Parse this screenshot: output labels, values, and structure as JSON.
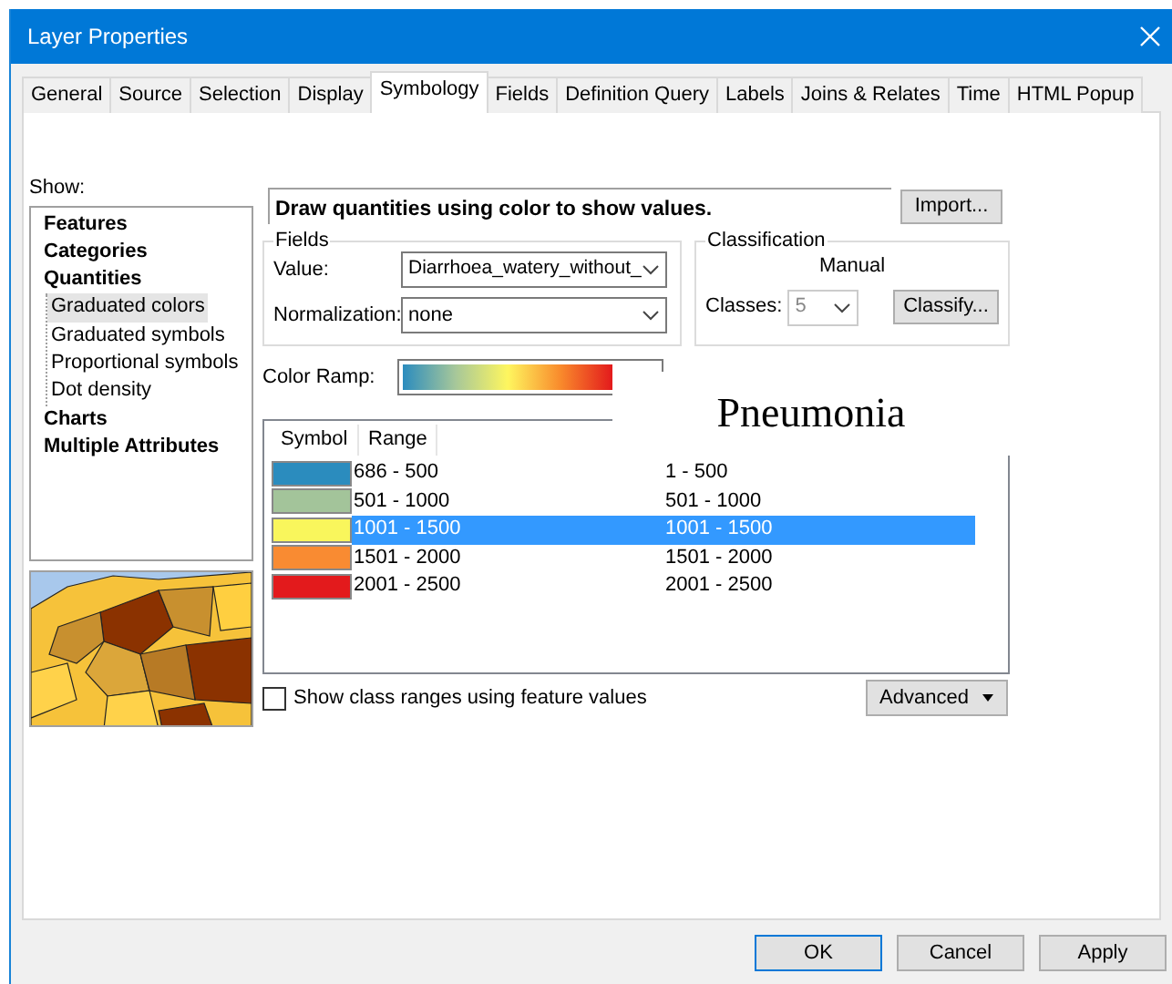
{
  "window": {
    "title": "Layer Properties"
  },
  "tabs": [
    {
      "label": "General",
      "selected": false
    },
    {
      "label": "Source",
      "selected": false
    },
    {
      "label": "Selection",
      "selected": false
    },
    {
      "label": "Display",
      "selected": false
    },
    {
      "label": "Symbology",
      "selected": true
    },
    {
      "label": "Fields",
      "selected": false
    },
    {
      "label": "Definition Query",
      "selected": false
    },
    {
      "label": "Labels",
      "selected": false
    },
    {
      "label": "Joins & Relates",
      "selected": false
    },
    {
      "label": "Time",
      "selected": false
    },
    {
      "label": "HTML Popup",
      "selected": false
    }
  ],
  "show": {
    "label": "Show:",
    "items": [
      {
        "label": "Features",
        "selected": false
      },
      {
        "label": "Categories",
        "selected": false
      },
      {
        "label": "Quantities",
        "selected": false,
        "children": [
          {
            "label": "Graduated colors",
            "selected": true
          },
          {
            "label": "Graduated symbols",
            "selected": false
          },
          {
            "label": "Proportional symbols",
            "selected": false
          },
          {
            "label": "Dot density",
            "selected": false
          }
        ]
      },
      {
        "label": "Charts",
        "selected": false
      },
      {
        "label": "Multiple Attributes",
        "selected": false
      }
    ]
  },
  "description": "Draw quantities using color to show values.",
  "import_button": "Import...",
  "fields": {
    "title": "Fields",
    "value_label": "Value:",
    "value": "Diarrhoea_watery_without_",
    "normalization_label": "Normalization:",
    "normalization": "none"
  },
  "classification": {
    "title": "Classification",
    "method": "Manual",
    "classes_label": "Classes:",
    "classes": "5",
    "classes_disabled": true,
    "classify_button": "Classify..."
  },
  "color_ramp": {
    "label": "Color Ramp:"
  },
  "caption": "Pneumonia",
  "table": {
    "columns": [
      "Symbol",
      "Range"
    ],
    "rows": [
      {
        "color": "#2b8cbe",
        "range": "686 - 500",
        "label": "1 - 500",
        "selected": false
      },
      {
        "color": "#a3c49a",
        "range": "501 - 1000",
        "label": "501 - 1000",
        "selected": false
      },
      {
        "color": "#f9f65c",
        "range": "1001 - 1500",
        "label": "1001 - 1500",
        "selected": true
      },
      {
        "color": "#f98b32",
        "range": "1501 - 2000",
        "label": "1501 - 2000",
        "selected": false
      },
      {
        "color": "#e31a1c",
        "range": "2001 - 2500",
        "label": "2001 - 2500",
        "selected": false
      }
    ]
  },
  "feature_values_checkbox": {
    "label": "Show class ranges using feature values",
    "checked": false
  },
  "advanced_button": "Advanced",
  "buttons": [
    {
      "label": "OK",
      "default": true
    },
    {
      "label": "Cancel",
      "default": false
    },
    {
      "label": "Apply",
      "default": false
    }
  ]
}
